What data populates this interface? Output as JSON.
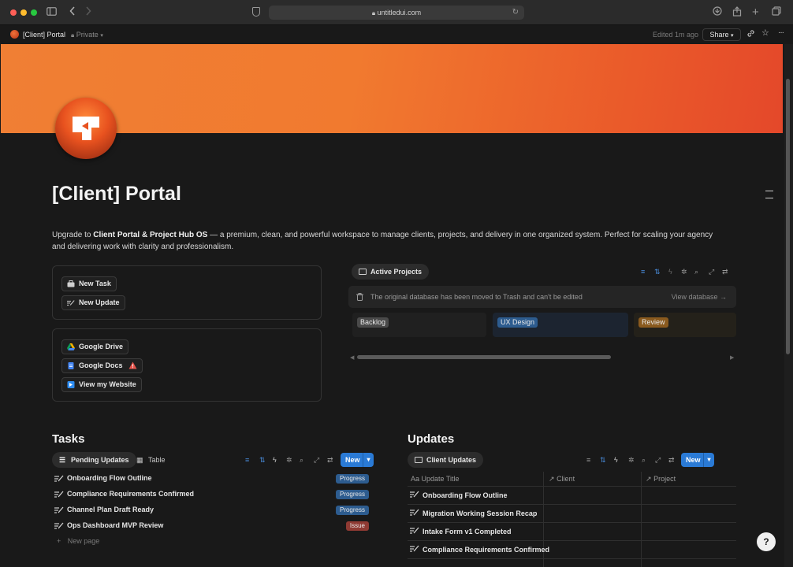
{
  "browser": {
    "url": "untitledui.com",
    "colors": {
      "close": "#fe5f57",
      "minimize": "#febc2e",
      "maximize": "#28c840"
    }
  },
  "topbar": {
    "page_name": "[Client] Portal",
    "privacy": "Private",
    "edited": "Edited 1m ago",
    "share_label": "Share"
  },
  "page": {
    "title": "[Client] Portal",
    "intro_prefix": "Upgrade to ",
    "intro_bold": "Client Portal & Project Hub OS",
    "intro_rest": " — a premium, clean, and powerful workspace to manage clients, projects, and delivery in one organized system. Perfect for scaling your agency and delivering work with clarity and professionalism."
  },
  "quick_actions": {
    "new_task": "New Task",
    "new_update": "New Update"
  },
  "links": {
    "drive": "Google Drive",
    "docs": "Google Docs",
    "website": "View my Website"
  },
  "active_projects": {
    "view_label": "Active Projects",
    "notice": "The original database has been moved to Trash and can't be edited",
    "view_database": "View database →",
    "columns": [
      {
        "label": "Backlog",
        "bg": "#202020",
        "tag": "#4a4a4a"
      },
      {
        "label": "UX Design",
        "bg": "#1c2430",
        "tag": "#2d5c8f"
      },
      {
        "label": "Review",
        "bg": "#24211a",
        "tag": "#8a5a1e"
      }
    ]
  },
  "tasks": {
    "title": "Tasks",
    "tab_active": "Pending Updates",
    "tab_other": "Table",
    "new_label": "New",
    "rows": [
      {
        "title": "Onboarding Flow Outline",
        "status": "Progress",
        "color": "#2d5c8f"
      },
      {
        "title": "Compliance Requirements Confirmed",
        "status": "Progress",
        "color": "#2d5c8f"
      },
      {
        "title": "Channel Plan Draft Ready",
        "status": "Progress",
        "color": "#2d5c8f"
      },
      {
        "title": "Ops Dashboard MVP Review",
        "status": "Issue",
        "color": "#8f3a33"
      }
    ],
    "new_page": "New page"
  },
  "updates": {
    "title": "Updates",
    "tab_active": "Client Updates",
    "new_label": "New",
    "headers": {
      "title": "Update Title",
      "client": "Client",
      "project": "Project"
    },
    "rows": [
      "Onboarding Flow Outline",
      "Migration Working Session Recap",
      "Intake Form v1 Completed",
      "Compliance Requirements Confirmed"
    ]
  },
  "help_label": "?"
}
